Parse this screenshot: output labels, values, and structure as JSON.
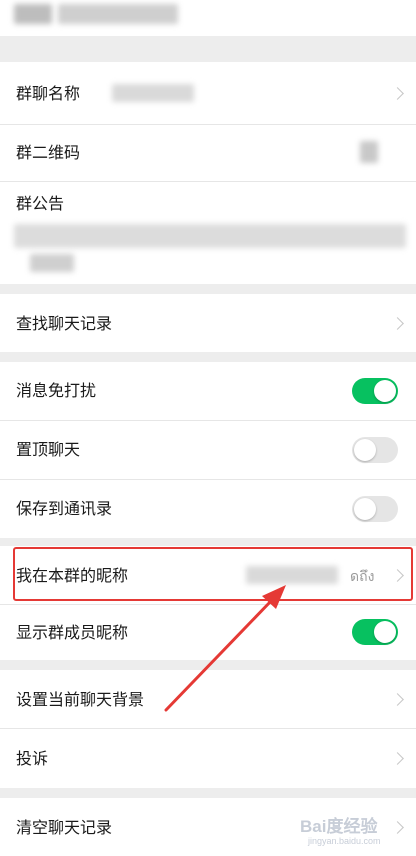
{
  "group_name_row": {
    "label": "群聊名称"
  },
  "qr_row": {
    "label": "群二维码",
    "icon": "qr-code-icon"
  },
  "notice_row": {
    "label": "群公告"
  },
  "search_history_row": {
    "label": "查找聊天记录"
  },
  "mute_row": {
    "label": "消息免打扰",
    "state": "on"
  },
  "pin_row": {
    "label": "置顶聊天",
    "state": "off"
  },
  "save_contacts_row": {
    "label": "保存到通讯录",
    "state": "off"
  },
  "nickname_row": {
    "label": "我在本群的昵称",
    "value_suffix": "ดถึง",
    "highlight_color": "#e53935"
  },
  "show_member_nick_row": {
    "label": "显示群成员昵称",
    "state": "on"
  },
  "background_row": {
    "label": "设置当前聊天背景"
  },
  "report_row": {
    "label": "投诉"
  },
  "clear_history_row": {
    "label": "清空聊天记录"
  },
  "watermark": {
    "text": "Bai度经验",
    "sub": "jingyan.baidu.com"
  },
  "colors": {
    "toggle_on": "#07c160",
    "toggle_off": "#e5e5e5",
    "annotation": "#e53935"
  }
}
